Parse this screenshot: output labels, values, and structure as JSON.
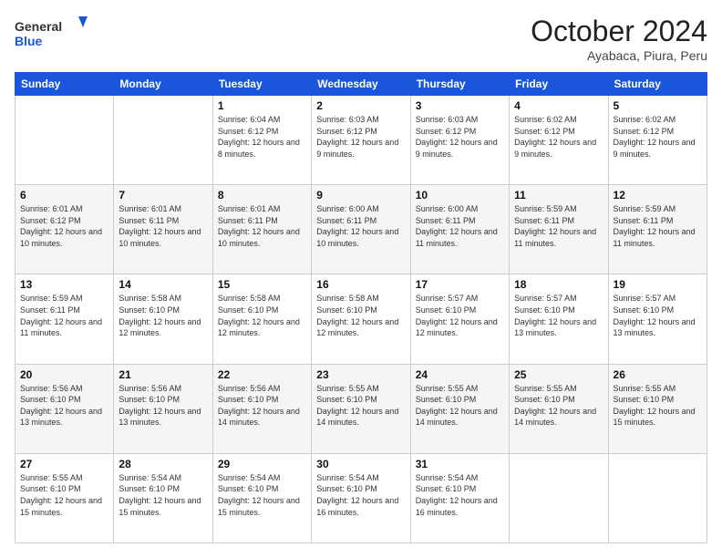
{
  "header": {
    "logo": {
      "general": "General",
      "blue": "Blue"
    },
    "month": "October 2024",
    "location": "Ayabaca, Piura, Peru"
  },
  "weekdays": [
    "Sunday",
    "Monday",
    "Tuesday",
    "Wednesday",
    "Thursday",
    "Friday",
    "Saturday"
  ],
  "weeks": [
    [
      {
        "day": "",
        "info": ""
      },
      {
        "day": "",
        "info": ""
      },
      {
        "day": "1",
        "info": "Sunrise: 6:04 AM\nSunset: 6:12 PM\nDaylight: 12 hours and 8 minutes."
      },
      {
        "day": "2",
        "info": "Sunrise: 6:03 AM\nSunset: 6:12 PM\nDaylight: 12 hours and 9 minutes."
      },
      {
        "day": "3",
        "info": "Sunrise: 6:03 AM\nSunset: 6:12 PM\nDaylight: 12 hours and 9 minutes."
      },
      {
        "day": "4",
        "info": "Sunrise: 6:02 AM\nSunset: 6:12 PM\nDaylight: 12 hours and 9 minutes."
      },
      {
        "day": "5",
        "info": "Sunrise: 6:02 AM\nSunset: 6:12 PM\nDaylight: 12 hours and 9 minutes."
      }
    ],
    [
      {
        "day": "6",
        "info": "Sunrise: 6:01 AM\nSunset: 6:12 PM\nDaylight: 12 hours and 10 minutes."
      },
      {
        "day": "7",
        "info": "Sunrise: 6:01 AM\nSunset: 6:11 PM\nDaylight: 12 hours and 10 minutes."
      },
      {
        "day": "8",
        "info": "Sunrise: 6:01 AM\nSunset: 6:11 PM\nDaylight: 12 hours and 10 minutes."
      },
      {
        "day": "9",
        "info": "Sunrise: 6:00 AM\nSunset: 6:11 PM\nDaylight: 12 hours and 10 minutes."
      },
      {
        "day": "10",
        "info": "Sunrise: 6:00 AM\nSunset: 6:11 PM\nDaylight: 12 hours and 11 minutes."
      },
      {
        "day": "11",
        "info": "Sunrise: 5:59 AM\nSunset: 6:11 PM\nDaylight: 12 hours and 11 minutes."
      },
      {
        "day": "12",
        "info": "Sunrise: 5:59 AM\nSunset: 6:11 PM\nDaylight: 12 hours and 11 minutes."
      }
    ],
    [
      {
        "day": "13",
        "info": "Sunrise: 5:59 AM\nSunset: 6:11 PM\nDaylight: 12 hours and 11 minutes."
      },
      {
        "day": "14",
        "info": "Sunrise: 5:58 AM\nSunset: 6:10 PM\nDaylight: 12 hours and 12 minutes."
      },
      {
        "day": "15",
        "info": "Sunrise: 5:58 AM\nSunset: 6:10 PM\nDaylight: 12 hours and 12 minutes."
      },
      {
        "day": "16",
        "info": "Sunrise: 5:58 AM\nSunset: 6:10 PM\nDaylight: 12 hours and 12 minutes."
      },
      {
        "day": "17",
        "info": "Sunrise: 5:57 AM\nSunset: 6:10 PM\nDaylight: 12 hours and 12 minutes."
      },
      {
        "day": "18",
        "info": "Sunrise: 5:57 AM\nSunset: 6:10 PM\nDaylight: 12 hours and 13 minutes."
      },
      {
        "day": "19",
        "info": "Sunrise: 5:57 AM\nSunset: 6:10 PM\nDaylight: 12 hours and 13 minutes."
      }
    ],
    [
      {
        "day": "20",
        "info": "Sunrise: 5:56 AM\nSunset: 6:10 PM\nDaylight: 12 hours and 13 minutes."
      },
      {
        "day": "21",
        "info": "Sunrise: 5:56 AM\nSunset: 6:10 PM\nDaylight: 12 hours and 13 minutes."
      },
      {
        "day": "22",
        "info": "Sunrise: 5:56 AM\nSunset: 6:10 PM\nDaylight: 12 hours and 14 minutes."
      },
      {
        "day": "23",
        "info": "Sunrise: 5:55 AM\nSunset: 6:10 PM\nDaylight: 12 hours and 14 minutes."
      },
      {
        "day": "24",
        "info": "Sunrise: 5:55 AM\nSunset: 6:10 PM\nDaylight: 12 hours and 14 minutes."
      },
      {
        "day": "25",
        "info": "Sunrise: 5:55 AM\nSunset: 6:10 PM\nDaylight: 12 hours and 14 minutes."
      },
      {
        "day": "26",
        "info": "Sunrise: 5:55 AM\nSunset: 6:10 PM\nDaylight: 12 hours and 15 minutes."
      }
    ],
    [
      {
        "day": "27",
        "info": "Sunrise: 5:55 AM\nSunset: 6:10 PM\nDaylight: 12 hours and 15 minutes."
      },
      {
        "day": "28",
        "info": "Sunrise: 5:54 AM\nSunset: 6:10 PM\nDaylight: 12 hours and 15 minutes."
      },
      {
        "day": "29",
        "info": "Sunrise: 5:54 AM\nSunset: 6:10 PM\nDaylight: 12 hours and 15 minutes."
      },
      {
        "day": "30",
        "info": "Sunrise: 5:54 AM\nSunset: 6:10 PM\nDaylight: 12 hours and 16 minutes."
      },
      {
        "day": "31",
        "info": "Sunrise: 5:54 AM\nSunset: 6:10 PM\nDaylight: 12 hours and 16 minutes."
      },
      {
        "day": "",
        "info": ""
      },
      {
        "day": "",
        "info": ""
      }
    ]
  ]
}
